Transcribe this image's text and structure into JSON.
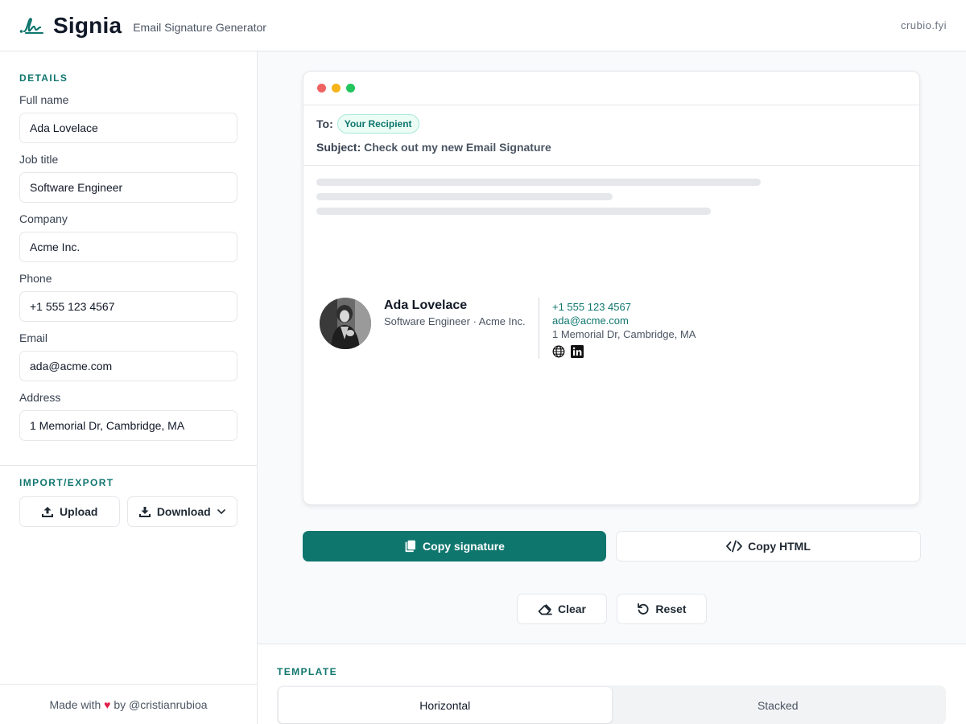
{
  "header": {
    "brand": "Signia",
    "tagline": "Email Signature Generator",
    "site_link": "crubio.fyi"
  },
  "details": {
    "section_title": "DETAILS",
    "fields": [
      {
        "label": "Full name",
        "value": "Ada Lovelace"
      },
      {
        "label": "Job title",
        "value": "Software Engineer"
      },
      {
        "label": "Company",
        "value": "Acme Inc."
      },
      {
        "label": "Phone",
        "value": "+1 555 123 4567"
      },
      {
        "label": "Email",
        "value": "ada@acme.com"
      },
      {
        "label": "Address",
        "value": "1 Memorial Dr, Cambridge, MA"
      }
    ]
  },
  "import_export": {
    "section_title": "IMPORT/EXPORT",
    "upload_label": "Upload",
    "download_label": "Download"
  },
  "footer": {
    "prefix": "Made with",
    "heart": "♥",
    "suffix": "by @cristianrubioa"
  },
  "preview": {
    "to_label": "To:",
    "recipient": "Your Recipient",
    "subject_label": "Subject:",
    "subject": "Check out my new Email Signature",
    "signature": {
      "name": "Ada Lovelace",
      "role": "Software Engineer · Acme Inc.",
      "phone": "+1 555 123 4567",
      "email": "ada@acme.com",
      "address": "1 Memorial Dr, Cambridge, MA",
      "icons": [
        "globe-icon",
        "linkedin-icon"
      ]
    }
  },
  "actions": {
    "copy_signature": "Copy signature",
    "copy_html": "Copy HTML",
    "clear": "Clear",
    "reset": "Reset"
  },
  "template": {
    "section_title": "TEMPLATE",
    "options": [
      "Horizontal",
      "Stacked"
    ],
    "selected": "Horizontal"
  },
  "colors": {
    "accent": "#0f766e",
    "heart": "#e11d48"
  }
}
